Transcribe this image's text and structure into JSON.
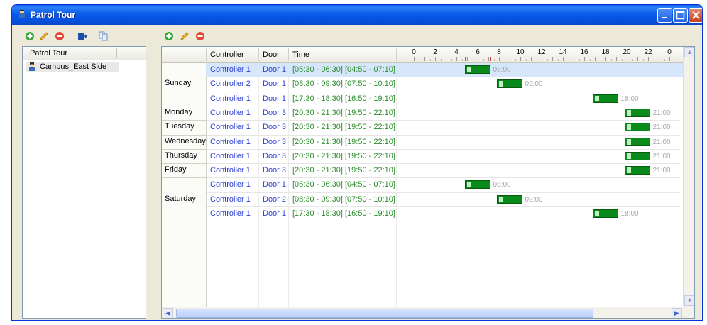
{
  "window": {
    "title": "Patrol Tour"
  },
  "left_panel": {
    "header": "Patrol Tour",
    "items": [
      {
        "label": "Campus_East Side"
      }
    ]
  },
  "grid": {
    "columns": {
      "controller": "Controller",
      "door": "Door",
      "time": "Time"
    },
    "ruler": [
      "0",
      "2",
      "4",
      "6",
      "8",
      "10",
      "12",
      "14",
      "16",
      "18",
      "20",
      "22",
      "0"
    ],
    "days": [
      {
        "label": "Sunday",
        "rows": [
          0,
          1,
          2
        ]
      },
      {
        "label": "Monday",
        "rows": [
          3
        ]
      },
      {
        "label": "Tuesday",
        "rows": [
          4
        ]
      },
      {
        "label": "Wednesday",
        "rows": [
          5
        ]
      },
      {
        "label": "Thursday",
        "rows": [
          6
        ]
      },
      {
        "label": "Friday",
        "rows": [
          7
        ]
      },
      {
        "label": "Saturday",
        "rows": [
          8,
          9,
          10
        ]
      }
    ],
    "rows": [
      {
        "controller": "Controller 1",
        "door": "Door 1",
        "time": "[05:30 - 06:30]  [04:50 - 07:10]",
        "bar_label": "06:00",
        "start_hour": 4.83,
        "end_hour": 7.17,
        "selected": true
      },
      {
        "controller": "Controller 2",
        "door": "Door 1",
        "time": "[08:30 - 09:30]  [07:50 - 10:10]",
        "bar_label": "09:00",
        "start_hour": 7.83,
        "end_hour": 10.17
      },
      {
        "controller": "Controller 1",
        "door": "Door 1",
        "time": "[17:30 - 18:30]  [16:50 - 19:10]",
        "bar_label": "18:00",
        "start_hour": 16.83,
        "end_hour": 19.17
      },
      {
        "controller": "Controller 1",
        "door": "Door 3",
        "time": "[20:30 - 21:30]  [19:50 - 22:10]",
        "bar_label": "21:00",
        "start_hour": 19.83,
        "end_hour": 22.17
      },
      {
        "controller": "Controller 1",
        "door": "Door 3",
        "time": "[20:30 - 21:30]  [19:50 - 22:10]",
        "bar_label": "21:00",
        "start_hour": 19.83,
        "end_hour": 22.17
      },
      {
        "controller": "Controller 1",
        "door": "Door 3",
        "time": "[20:30 - 21:30]  [19:50 - 22:10]",
        "bar_label": "21:00",
        "start_hour": 19.83,
        "end_hour": 22.17
      },
      {
        "controller": "Controller 1",
        "door": "Door 3",
        "time": "[20:30 - 21:30]  [19:50 - 22:10]",
        "bar_label": "21:00",
        "start_hour": 19.83,
        "end_hour": 22.17
      },
      {
        "controller": "Controller 1",
        "door": "Door 3",
        "time": "[20:30 - 21:30]  [19:50 - 22:10]",
        "bar_label": "21:00",
        "start_hour": 19.83,
        "end_hour": 22.17
      },
      {
        "controller": "Controller 1",
        "door": "Door 1",
        "time": "[05:30 - 06:30]  [04:50 - 07:10]",
        "bar_label": "06:00",
        "start_hour": 4.83,
        "end_hour": 7.17
      },
      {
        "controller": "Controller 1",
        "door": "Door 2",
        "time": "[08:30 - 09:30]  [07:50 - 10:10]",
        "bar_label": "09:00",
        "start_hour": 7.83,
        "end_hour": 10.17
      },
      {
        "controller": "Controller 1",
        "door": "Door 1",
        "time": "[17:30 - 18:30]  [16:50 - 19:10]",
        "bar_label": "18:00",
        "start_hour": 16.83,
        "end_hour": 19.17
      }
    ]
  },
  "icons": {
    "left_toolbar": [
      "add-icon",
      "edit-icon",
      "delete-icon",
      "export-icon",
      "copy-icon"
    ],
    "right_toolbar": [
      "add-icon",
      "edit-icon",
      "delete-icon"
    ]
  },
  "colors": {
    "controller": "#2a3fd8",
    "time": "#2c8c2c",
    "bar": "#0a8a1a",
    "title_bar": "#0a5ce8"
  }
}
